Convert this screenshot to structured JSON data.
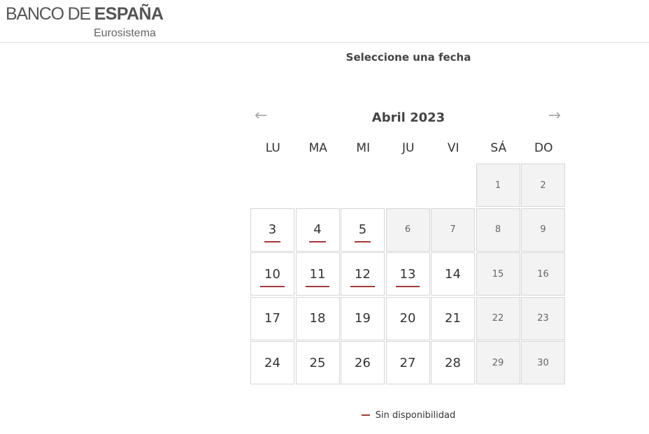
{
  "brand": {
    "name_light": "BANCO DE ",
    "name_bold": "ESPAÑA",
    "subtitle": "Eurosistema"
  },
  "page": {
    "title": "Seleccione una fecha"
  },
  "calendar": {
    "month_label": "Abril 2023",
    "prev_icon": "←",
    "next_icon": "→",
    "weekdays": [
      "LU",
      "MA",
      "MI",
      "JU",
      "VI",
      "SÁ",
      "DO"
    ],
    "weeks": [
      [
        null,
        null,
        null,
        null,
        null,
        {
          "day": "1",
          "state": "disabled"
        },
        {
          "day": "2",
          "state": "disabled"
        }
      ],
      [
        {
          "day": "3",
          "state": "unavailable"
        },
        {
          "day": "4",
          "state": "unavailable"
        },
        {
          "day": "5",
          "state": "unavailable"
        },
        {
          "day": "6",
          "state": "disabled"
        },
        {
          "day": "7",
          "state": "disabled"
        },
        {
          "day": "8",
          "state": "disabled"
        },
        {
          "day": "9",
          "state": "disabled"
        }
      ],
      [
        {
          "day": "10",
          "state": "unavailable"
        },
        {
          "day": "11",
          "state": "unavailable"
        },
        {
          "day": "12",
          "state": "unavailable"
        },
        {
          "day": "13",
          "state": "unavailable"
        },
        {
          "day": "14",
          "state": "available"
        },
        {
          "day": "15",
          "state": "disabled"
        },
        {
          "day": "16",
          "state": "disabled"
        }
      ],
      [
        {
          "day": "17",
          "state": "available"
        },
        {
          "day": "18",
          "state": "available"
        },
        {
          "day": "19",
          "state": "available"
        },
        {
          "day": "20",
          "state": "available"
        },
        {
          "day": "21",
          "state": "available"
        },
        {
          "day": "22",
          "state": "disabled"
        },
        {
          "day": "23",
          "state": "disabled"
        }
      ],
      [
        {
          "day": "24",
          "state": "available"
        },
        {
          "day": "25",
          "state": "available"
        },
        {
          "day": "26",
          "state": "available"
        },
        {
          "day": "27",
          "state": "available"
        },
        {
          "day": "28",
          "state": "available"
        },
        {
          "day": "29",
          "state": "disabled"
        },
        {
          "day": "30",
          "state": "disabled"
        }
      ]
    ]
  },
  "legend": {
    "unavailable_label": "Sin disponibilidad"
  },
  "colors": {
    "unavailable_underline": "#a33a3a",
    "disabled_cell_bg": "#f3f3f3",
    "cell_border": "#d6d6d6"
  }
}
